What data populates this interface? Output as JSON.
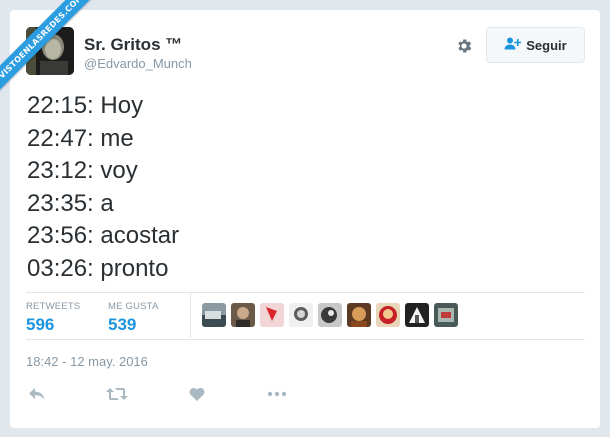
{
  "watermark": {
    "text": "VISTOENLASREDES.COM"
  },
  "user": {
    "name": "Sr. Gritos ™",
    "handle": "@Edvardo_Munch"
  },
  "actions": {
    "settings_icon": "gear-icon",
    "follow_label": "Seguir",
    "follow_icon": "add-user-icon"
  },
  "tweet": {
    "lines": [
      "22:15: Hoy",
      "22:47: me",
      "23:12: voy",
      "23:35: a",
      "23:56: acostar",
      "03:26: pronto"
    ]
  },
  "stats": {
    "retweets_label": "RETWEETS",
    "retweets_count": "596",
    "likes_label": "ME GUSTA",
    "likes_count": "539"
  },
  "likers_count": 9,
  "timestamp": "18:42 - 12 may. 2016",
  "footer_actions": [
    "reply-icon",
    "retweet-icon",
    "like-icon",
    "more-icon"
  ],
  "colors": {
    "accent": "#1b95e0",
    "text": "#292f33",
    "muted": "#8899a6",
    "watermark": "#2b9de0"
  }
}
